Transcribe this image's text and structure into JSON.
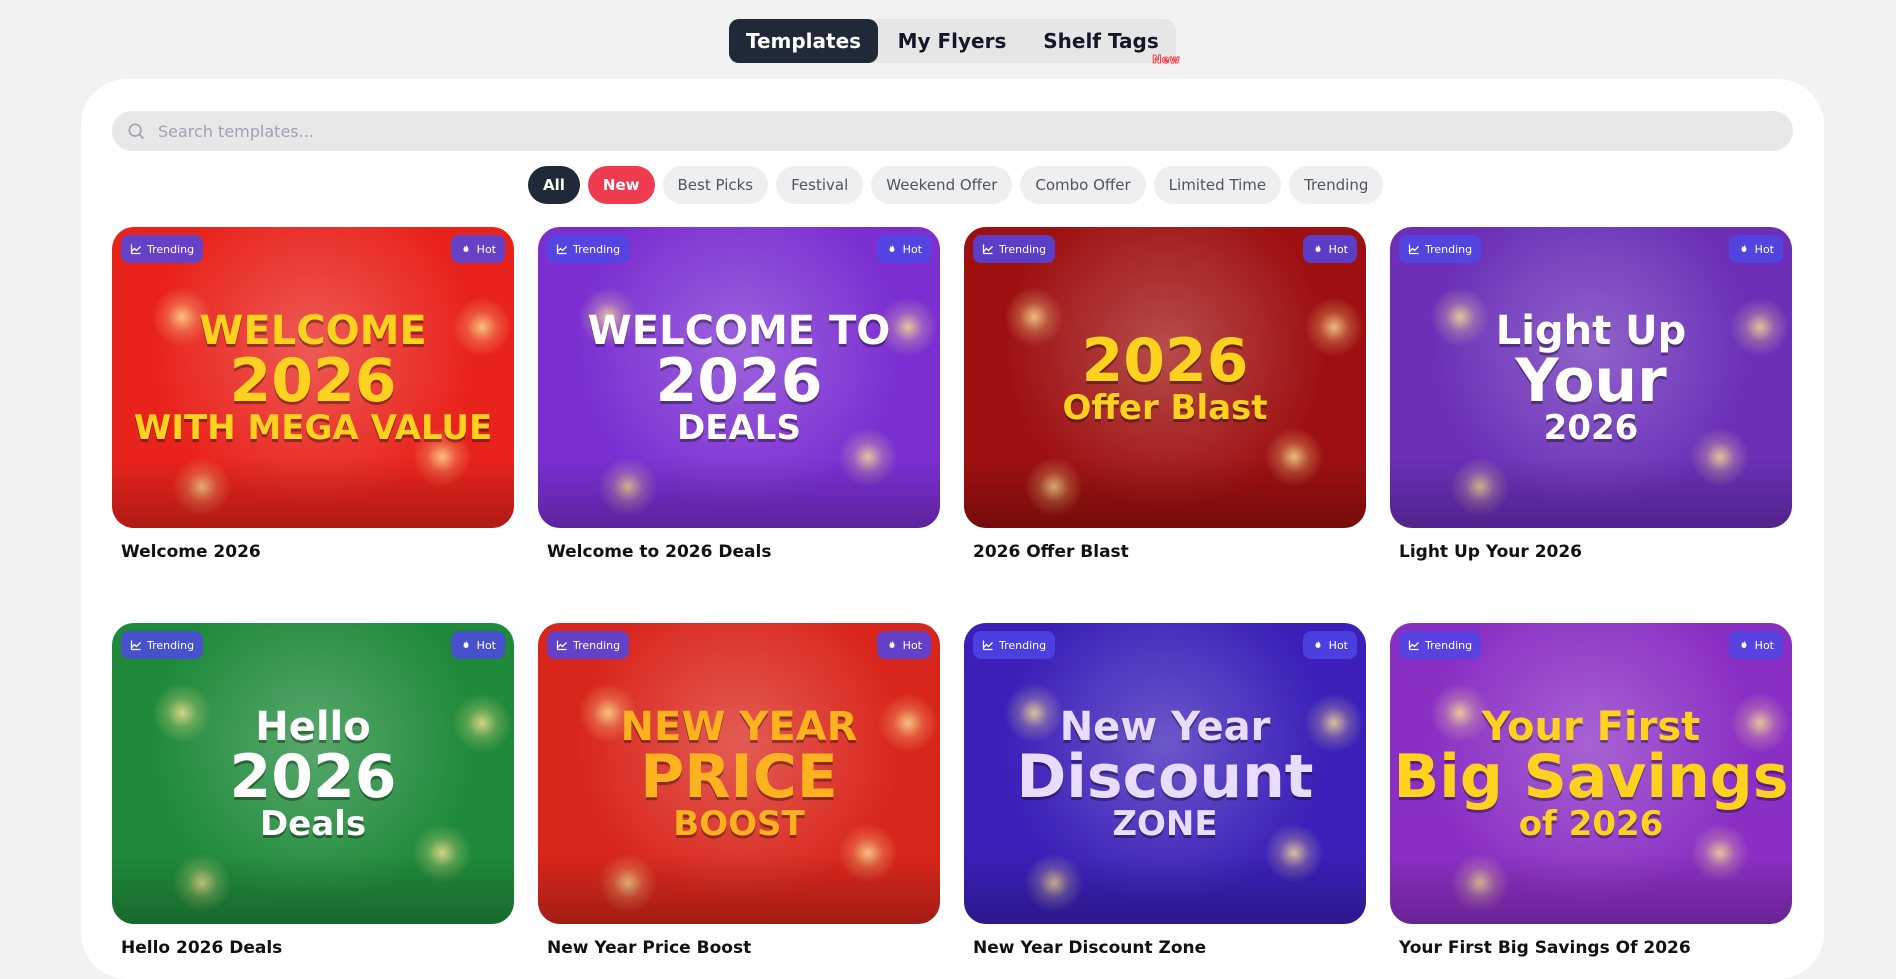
{
  "tabs": [
    {
      "label": "Templates",
      "active": true
    },
    {
      "label": "My Flyers",
      "active": false
    },
    {
      "label": "Shelf Tags",
      "active": false,
      "badge": "New"
    }
  ],
  "search": {
    "placeholder": "Search templates..."
  },
  "filters": [
    "All",
    "New",
    "Best Picks",
    "Festival",
    "Weekend Offer",
    "Combo Offer",
    "Limited Time",
    "Trending"
  ],
  "badges": {
    "trending": "Trending",
    "hot": "Hot"
  },
  "templates": [
    {
      "title": "Welcome 2026",
      "art": [
        "WELCOME",
        "2026",
        "WITH MEGA VALUE"
      ],
      "bg": "#e8231c",
      "text_color": "#ffd21f"
    },
    {
      "title": "Welcome to 2026 Deals",
      "art": [
        "WELCOME TO",
        "2026",
        "DEALS"
      ],
      "bg": "#7b2fd1",
      "text_color": "#ffffff"
    },
    {
      "title": "2026 Offer Blast",
      "art": [
        "",
        "2026",
        "Offer Blast"
      ],
      "bg": "#9e1010",
      "text_color": "#ffd21f"
    },
    {
      "title": "Light Up Your 2026",
      "art": [
        "Light Up",
        "Your",
        "2026"
      ],
      "bg": "#6b2fb8",
      "text_color": "#ffffff"
    },
    {
      "title": "Hello 2026 Deals",
      "art": [
        "Hello",
        "2026",
        "Deals"
      ],
      "bg": "#1f8a3a",
      "text_color": "#ffffff"
    },
    {
      "title": "New Year Price Boost",
      "art": [
        "NEW YEAR",
        "PRICE",
        "BOOST"
      ],
      "bg": "#d9261c",
      "text_color": "#ffb21f"
    },
    {
      "title": "New Year Discount Zone",
      "art": [
        "New Year",
        "Discount",
        "ZONE"
      ],
      "bg": "#3b1fb8",
      "text_color": "#e9dcff"
    },
    {
      "title": "Your First Big Savings Of 2026",
      "art": [
        "Your First",
        "Big Savings",
        "of 2026"
      ],
      "bg": "#8a2fc4",
      "text_color": "#ffd21f"
    }
  ]
}
